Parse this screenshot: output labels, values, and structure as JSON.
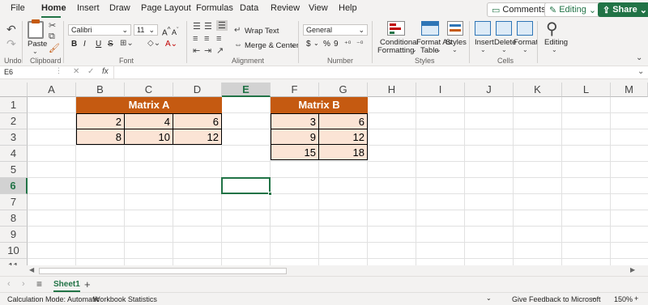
{
  "menu": {
    "items": [
      "File",
      "Home",
      "Insert",
      "Draw",
      "Page Layout",
      "Formulas",
      "Data",
      "Review",
      "View",
      "Help"
    ],
    "comments": "Comments",
    "editing": "Editing",
    "share": "Share"
  },
  "ribbon": {
    "undo_group": "Undo",
    "clipboard_group": "Clipboard",
    "paste": "Paste",
    "font_group": "Font",
    "font_name": "Calibri",
    "font_size": "11",
    "alignment_group": "Alignment",
    "wrap_text": "Wrap Text",
    "merge_center": "Merge & Center",
    "number_group": "Number",
    "number_format": "General",
    "styles_group": "Styles",
    "conditional": "Conditional",
    "formatting": "Formatting",
    "format_as": "Format As",
    "table": "Table",
    "styles": "Styles",
    "cells_group": "Cells",
    "insert": "Insert",
    "delete": "Delete",
    "format": "Format",
    "editing": "Editing",
    "bold": "B",
    "italic": "I",
    "underline": "U",
    "strike": "S",
    "currency": "$",
    "percent": "%",
    "comma": "9",
    "fx": "fx"
  },
  "formula_bar": {
    "name_box": "E6",
    "formula": ""
  },
  "grid": {
    "columns": [
      "A",
      "B",
      "C",
      "D",
      "E",
      "F",
      "G",
      "H",
      "I",
      "J",
      "K",
      "L",
      "M"
    ],
    "rows": [
      "1",
      "2",
      "3",
      "4",
      "5",
      "6",
      "7",
      "8",
      "9",
      "10",
      "11"
    ],
    "selected_column": "E",
    "selected_row": "6",
    "matrix_a": {
      "title": "Matrix A",
      "values": [
        [
          "2",
          "4",
          "6"
        ],
        [
          "8",
          "10",
          "12"
        ]
      ]
    },
    "matrix_b": {
      "title": "Matrix B",
      "values": [
        [
          "3",
          "6"
        ],
        [
          "9",
          "12"
        ],
        [
          "15",
          "18"
        ]
      ]
    }
  },
  "sheet_tabs": {
    "active": "Sheet1",
    "add": "+",
    "menu": "≡",
    "prev": "‹",
    "next": "›"
  },
  "status": {
    "calc_mode": "Calculation Mode: Automatic",
    "workbook_stats": "Workbook Statistics",
    "feedback": "Give Feedback to Microsoft",
    "zoom": "150%",
    "zoom_minus": "−",
    "zoom_plus": "+"
  }
}
